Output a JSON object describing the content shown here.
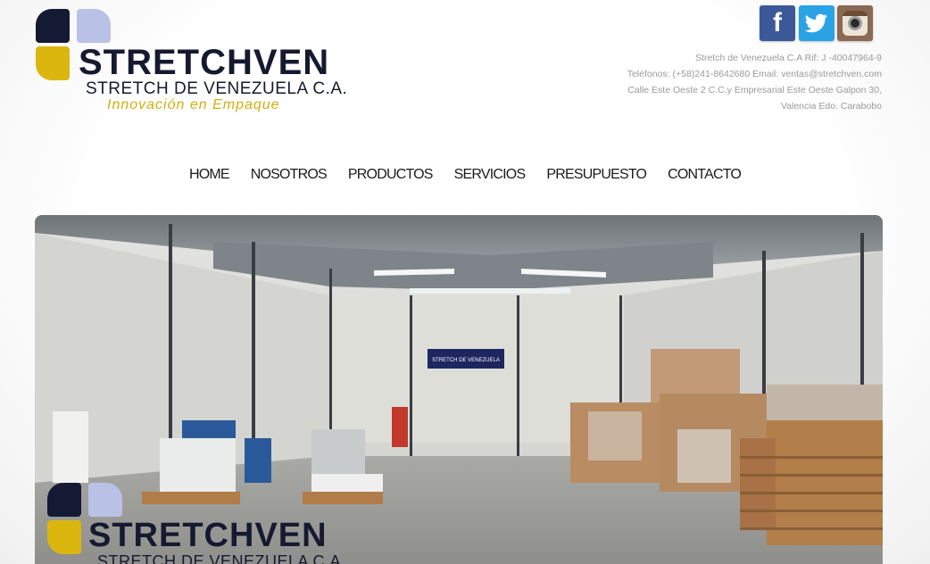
{
  "logo": {
    "brand": "STRETCHVEN",
    "subtitle": "STRETCH DE VENEZUELA C.A.",
    "tagline": "Innovación en Empaque",
    "colors": {
      "navy": "#141a33",
      "lavender": "#b9c2e6",
      "gold": "#dbb60f"
    }
  },
  "social": [
    {
      "name": "facebook-icon",
      "glyph": "f"
    },
    {
      "name": "twitter-icon",
      "glyph": "bird"
    },
    {
      "name": "instagram-icon",
      "glyph": "camera"
    }
  ],
  "contact": {
    "line1": "Stretch de Venezuela C.A Rif: J -40047964-9",
    "line2": "Teléfonos: (+58)241-8642680 Email: ventas@stretchven.com",
    "line3": "Calle Este Oeste 2 C.C.y Empresarial Este Oeste Galpon 30,",
    "line4": "Valencia Edo. Carabobo"
  },
  "nav": {
    "home": "HOME",
    "nosotros": "NOSOTROS",
    "productos": "PRODUCTOS",
    "servicios": "SERVICIOS",
    "presupuesto": "PRESUPUESTO",
    "contacto": "CONTACTO"
  },
  "hero": {
    "banner_text": "STRETCH DE VENEZUELA",
    "logo_brand": "STRETCHVEN",
    "logo_subtitle": "STRETCH DE VENEZUELA C.A."
  }
}
